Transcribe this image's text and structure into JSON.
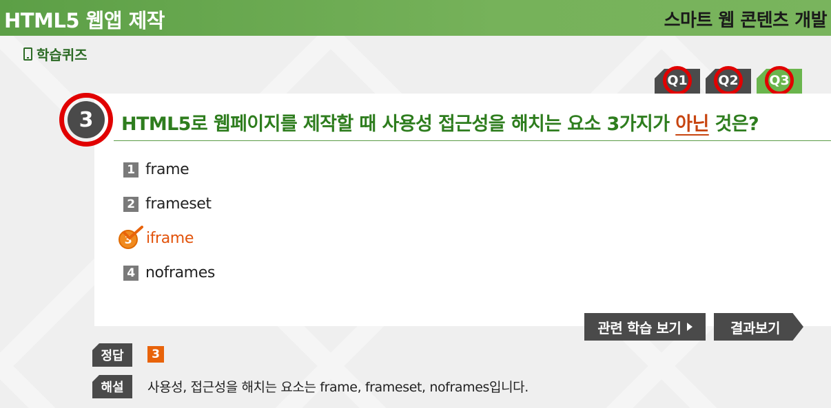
{
  "header": {
    "title": "HTML5 웹앱 제작",
    "subtitle": "스마트 웹 콘텐츠 개발"
  },
  "section": {
    "icon": "phone-icon",
    "label": "학습퀴즈"
  },
  "quiz_tabs": [
    {
      "label": "Q1",
      "active": false
    },
    {
      "label": "Q2",
      "active": false
    },
    {
      "label": "Q3",
      "active": true
    }
  ],
  "question": {
    "number": "3",
    "text_before": "HTML5로 웹페이지를 제작할 때 사용성 접근성을 해치는 요소 3가지가 ",
    "text_emphasis": "아닌",
    "text_after": " 것은?"
  },
  "options": [
    {
      "num": "1",
      "text": "frame",
      "selected": false
    },
    {
      "num": "2",
      "text": "frameset",
      "selected": false
    },
    {
      "num": "3",
      "text": "iframe",
      "selected": true
    },
    {
      "num": "4",
      "text": "noframes",
      "selected": false
    }
  ],
  "buttons": {
    "related": "관련 학습 보기",
    "result": "결과보기"
  },
  "answer": {
    "label": "정답",
    "value": "3"
  },
  "explanation": {
    "label": "해설",
    "text": "사용성, 접근성을 해치는 요소는 frame, frameset, noframes입니다."
  },
  "colors": {
    "header_green": "#6aaa50",
    "tab_active": "#6ab54d",
    "highlight_ring": "#e10000",
    "selected_option": "#e2520a",
    "question_text": "#2e7d1e"
  }
}
